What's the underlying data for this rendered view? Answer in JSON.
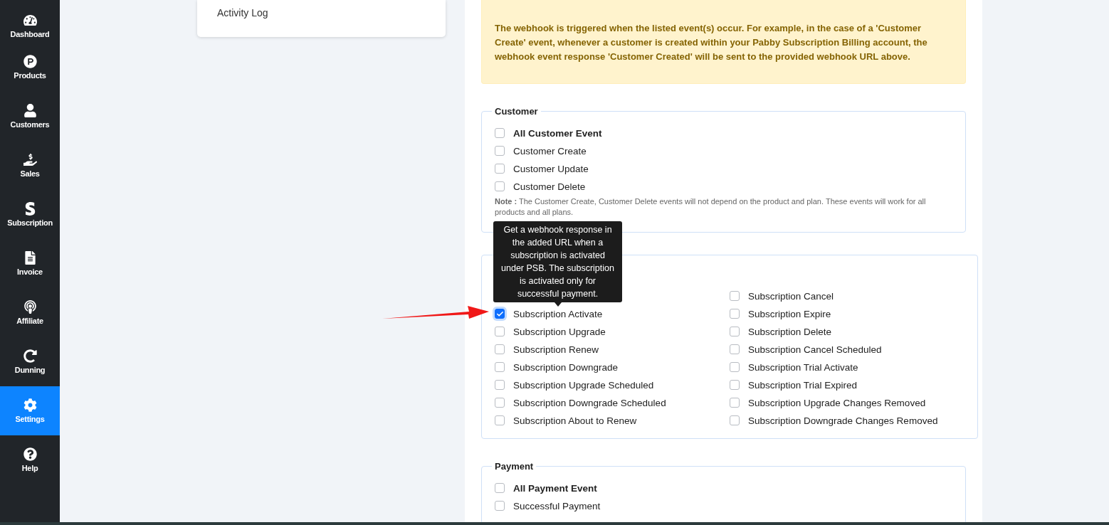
{
  "sidebar": {
    "items": [
      {
        "label": "Dashboard",
        "kind": "gauge",
        "selected": false
      },
      {
        "label": "Products",
        "kind": "product",
        "selected": false
      },
      {
        "label": "Customers",
        "kind": "user",
        "selected": false
      },
      {
        "label": "Sales",
        "kind": "sales",
        "selected": false
      },
      {
        "label": "Subscription",
        "kind": "subscription",
        "selected": false
      },
      {
        "label": "Invoice",
        "kind": "invoice",
        "selected": false
      },
      {
        "label": "Affiliate",
        "kind": "affiliate",
        "selected": false
      },
      {
        "label": "Dunning",
        "kind": "redo",
        "selected": false
      },
      {
        "label": "Settings",
        "kind": "gear",
        "selected": true
      },
      {
        "label": "Help",
        "kind": "help",
        "selected": false
      }
    ]
  },
  "settings_menu": {
    "items": [
      {
        "label": "Activity Log"
      }
    ]
  },
  "notice": "The webhook is triggered when the listed event(s) occur. For example, in the case of a 'Customer Create' event, whenever a customer is created within your Pabby Subscription Billing account, the webhook event response 'Customer Created' will be sent to the provided webhook URL above.",
  "groups": [
    {
      "legend": "Customer",
      "columns": [
        [
          {
            "kind": "all",
            "label": "All Customer Event",
            "checked": false
          },
          {
            "kind": "event",
            "label": "Customer Create",
            "checked": false
          },
          {
            "kind": "event",
            "label": "Customer Update",
            "checked": false
          },
          {
            "kind": "event",
            "label": "Customer Delete",
            "checked": false
          }
        ]
      ],
      "note_label": "Note :",
      "note": "The Customer Create, Customer Delete events will not depend on the product and plan. These events will work for all products and all plans."
    },
    {
      "columns": [
        [
          {
            "kind": "event",
            "label": "Subscription Activate",
            "checked": true,
            "tooltip": "Get a webhook response in the added URL when a subscription is activated under PSB. The subscription is activated only for successful payment."
          },
          {
            "kind": "event",
            "label": "Subscription Upgrade",
            "checked": false
          },
          {
            "kind": "event",
            "label": "Subscription Renew",
            "checked": false
          },
          {
            "kind": "event",
            "label": "Subscription Downgrade",
            "checked": false
          },
          {
            "kind": "event",
            "label": "Subscription Upgrade Scheduled",
            "checked": false
          },
          {
            "kind": "event",
            "label": "Subscription Downgrade Scheduled",
            "checked": false
          },
          {
            "kind": "event",
            "label": "Subscription About to Renew",
            "checked": false
          }
        ],
        [
          {
            "kind": "event",
            "label": "Subscription Cancel",
            "checked": false
          },
          {
            "kind": "event",
            "label": "Subscription Expire",
            "checked": false
          },
          {
            "kind": "event",
            "label": "Subscription Delete",
            "checked": false
          },
          {
            "kind": "event",
            "label": "Subscription Cancel Scheduled",
            "checked": false
          },
          {
            "kind": "event",
            "label": "Subscription Trial Activate",
            "checked": false
          },
          {
            "kind": "event",
            "label": "Subscription Trial Expired",
            "checked": false
          },
          {
            "kind": "event",
            "label": "Subscription Upgrade Changes Removed",
            "checked": false
          },
          {
            "kind": "event",
            "label": "Subscription Downgrade Changes Removed",
            "checked": false
          }
        ]
      ]
    },
    {
      "legend": "Payment",
      "columns": [
        [
          {
            "kind": "all",
            "label": "All Payment Event",
            "checked": false
          },
          {
            "kind": "event",
            "label": "Successful Payment",
            "checked": false
          }
        ]
      ]
    }
  ]
}
